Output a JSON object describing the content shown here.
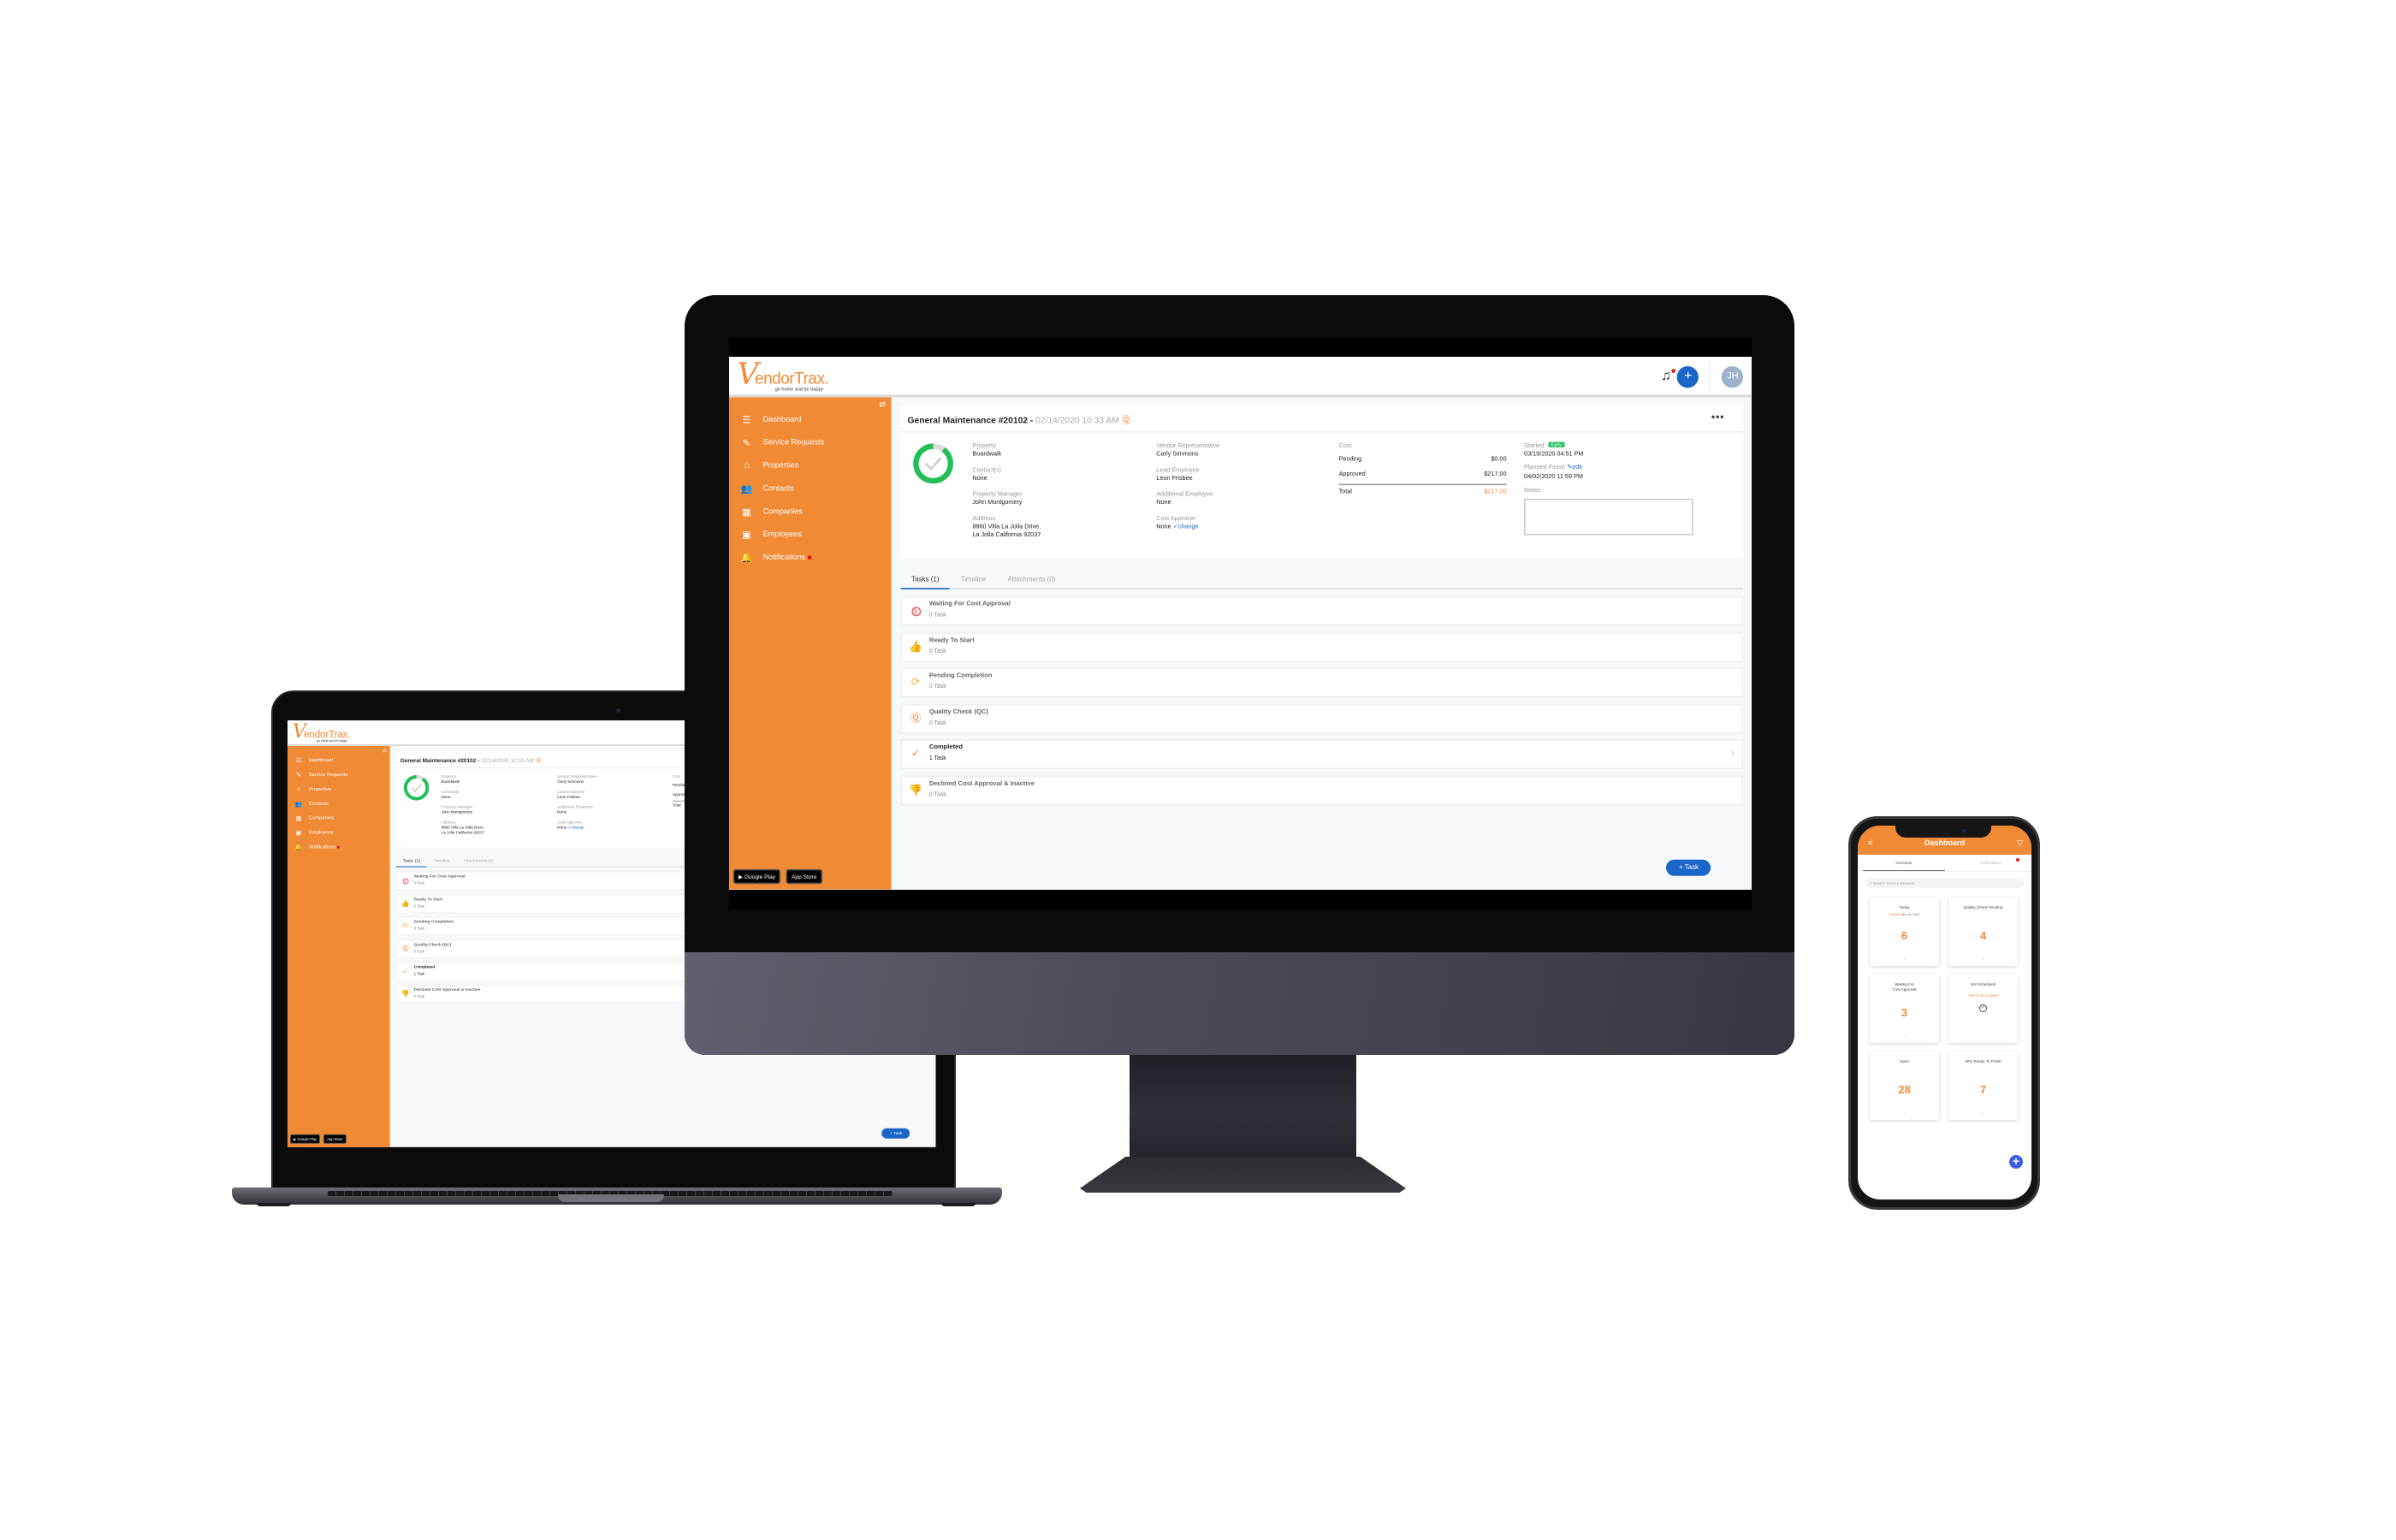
{
  "brand": {
    "logo_letter": "V",
    "logo_text": "endorTrax.",
    "tagline": "go home and be happy",
    "accent_color": "#f08a35",
    "primary_color": "#1a66c9"
  },
  "header": {
    "add_label": "+",
    "avatar_initials": "JH"
  },
  "sidebar": {
    "collapse_icon": "⇄",
    "items": [
      {
        "label": "Dashboard",
        "icon": "☰"
      },
      {
        "label": "Service Requests",
        "icon": "✎"
      },
      {
        "label": "Properties",
        "icon": "⌂"
      },
      {
        "label": "Contacts",
        "icon": "👥"
      },
      {
        "label": "Companies",
        "icon": "▦"
      },
      {
        "label": "Employees",
        "icon": "▣"
      },
      {
        "label": "Notifications",
        "icon": "🔔"
      }
    ],
    "store_badges": {
      "google_play": "▶ Google Play",
      "app_store": " App Store"
    }
  },
  "request": {
    "title": "General Maintenance #20102",
    "separator": " - ",
    "date": "02/14/2020 10:33 AM",
    "more_label": "•••",
    "progress": 0.9,
    "fields": {
      "property_label": "Property",
      "property": "Boardwalk",
      "contacts_label": "Contact(s)",
      "contacts": "None",
      "property_manager_label": "Property Manager",
      "property_manager": "John Montgomery",
      "address_label": "Address",
      "address_line1": "8860 Villa La Jolla Drive,",
      "address_line2": "La Jolla California 92037",
      "vendor_rep_label": "Vendor Representative",
      "vendor_rep": "Carly Simmons",
      "lead_employee_label": "Lead Employee",
      "lead_employee": "Leon Frisbee",
      "additional_employee_label": "Additional Employee",
      "additional_employee": "None",
      "cost_approver_label": "Cost Approver",
      "cost_approver": "None",
      "change_link": "✓change"
    },
    "cost": {
      "label": "Cost",
      "pending_label": "Pending",
      "pending": "$0.00",
      "approved_label": "Approved",
      "approved": "$217.00",
      "total_label": "Total",
      "total": "$217.00"
    },
    "schedule": {
      "started_label": "Started",
      "early_badge": "Early",
      "started": "03/19/2020 04:51 PM",
      "planned_finish_label": "Planned Finish",
      "edit_link": "✎edit",
      "planned_finish": "04/02/2020 11:59 PM",
      "notes_label": "Notes",
      "notes": ""
    },
    "tabs": [
      {
        "label": "Tasks (1)",
        "active": true
      },
      {
        "label": "Timeline",
        "active": false
      },
      {
        "label": "Attachments (0)",
        "active": false
      }
    ],
    "task_groups": [
      {
        "name": "Waiting For Cost Approval",
        "count": "0 Task",
        "icon": "$",
        "color": "#e96565"
      },
      {
        "name": "Ready To Start",
        "count": "0 Task",
        "icon": "👍",
        "color": "#3fbf6f"
      },
      {
        "name": "Pending Completion",
        "count": "0 Task",
        "icon": "⟳",
        "color": "#f5b342"
      },
      {
        "name": "Quality Check (QC)",
        "count": "0 Task",
        "icon": "Ⓠ",
        "color": "#f08a35"
      },
      {
        "name": "Completed",
        "count": "1 Task",
        "icon": "✓",
        "color": "#f08a35"
      },
      {
        "name": "Declined Cost Approval & Inactive",
        "count": "0 Task",
        "icon": "👎",
        "color": "#999999"
      }
    ],
    "add_task_label": "+ Task"
  },
  "mobile": {
    "title": "Dashboard",
    "menu_icon": "≡",
    "filter_icon": "▽",
    "tabs": [
      "Overview",
      "Notifications"
    ],
    "search_placeholder": "Search Service Request",
    "cards": [
      {
        "title": "Today",
        "sub_day": "Tuesday",
        "sub_date": " Mar 24, 2020",
        "value": "6"
      },
      {
        "title": "Quality Check Pending",
        "value": "4"
      },
      {
        "title": "Waiting For\nCost Approval",
        "value": "3"
      },
      {
        "title": "Not Scheduled",
        "message": "You're up to date!"
      },
      {
        "title": "Open",
        "value": "28"
      },
      {
        "title": "90% Ready To Finish",
        "value": "7"
      }
    ],
    "chevron": "⌄",
    "fab_label": "+"
  }
}
